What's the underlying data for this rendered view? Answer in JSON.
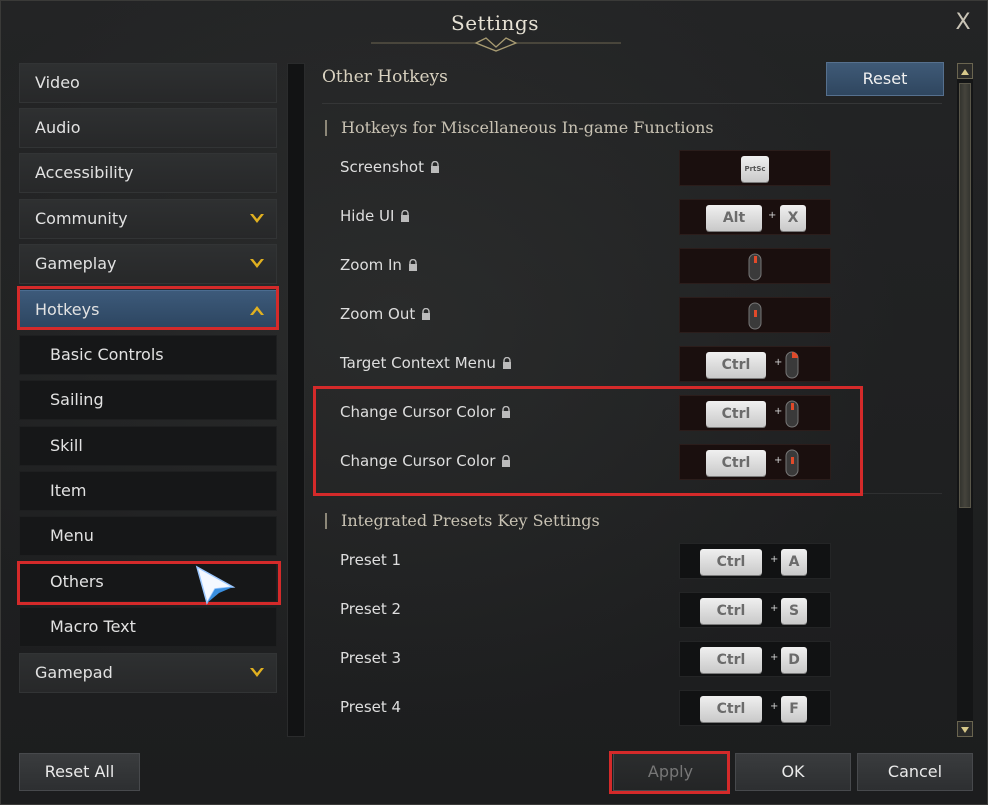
{
  "window": {
    "title": "Settings",
    "close_glyph": "X"
  },
  "sidebar": {
    "items": [
      {
        "label": "Video"
      },
      {
        "label": "Audio"
      },
      {
        "label": "Accessibility"
      },
      {
        "label": "Community",
        "expandable": true
      },
      {
        "label": "Gameplay",
        "expandable": true
      },
      {
        "label": "Hotkeys",
        "expanded": true,
        "active": true
      },
      {
        "label": "Basic Controls",
        "sub": true
      },
      {
        "label": "Sailing",
        "sub": true
      },
      {
        "label": "Skill",
        "sub": true
      },
      {
        "label": "Item",
        "sub": true
      },
      {
        "label": "Menu",
        "sub": true
      },
      {
        "label": "Others",
        "sub": true,
        "selected": true
      },
      {
        "label": "Macro Text",
        "sub": true
      },
      {
        "label": "Gamepad",
        "expandable": true
      }
    ]
  },
  "main": {
    "title": "Other Hotkeys",
    "reset_label": "Reset",
    "sections": [
      {
        "title": "Hotkeys for Miscellaneous In-game Functions",
        "rows": [
          {
            "label": "Screenshot",
            "locked": true,
            "keys": [
              "PrtSc"
            ]
          },
          {
            "label": "Hide UI",
            "locked": true,
            "keys": [
              "Alt",
              "X"
            ]
          },
          {
            "label": "Zoom In",
            "locked": true,
            "keys": [
              "mouse-wheel-up"
            ]
          },
          {
            "label": "Zoom Out",
            "locked": true,
            "keys": [
              "mouse-wheel-down"
            ]
          },
          {
            "label": "Target Context Menu",
            "locked": true,
            "keys": [
              "Ctrl",
              "mouse-right"
            ]
          },
          {
            "label": "Change Cursor Color",
            "locked": true,
            "keys": [
              "Ctrl",
              "mouse-wheel-up"
            ]
          },
          {
            "label": "Change Cursor Color",
            "locked": true,
            "keys": [
              "Ctrl",
              "mouse-wheel-down"
            ]
          }
        ]
      },
      {
        "title": "Integrated Presets Key Settings",
        "rows": [
          {
            "label": "Preset 1",
            "keys": [
              "Ctrl",
              "A"
            ]
          },
          {
            "label": "Preset 2",
            "keys": [
              "Ctrl",
              "S"
            ]
          },
          {
            "label": "Preset 3",
            "keys": [
              "Ctrl",
              "D"
            ]
          },
          {
            "label": "Preset 4",
            "keys": [
              "Ctrl",
              "F"
            ]
          }
        ]
      }
    ],
    "plus_glyph": "+"
  },
  "footer": {
    "reset_all_label": "Reset All",
    "apply_label": "Apply",
    "ok_label": "OK",
    "cancel_label": "Cancel"
  },
  "colors": {
    "accent_blue": "#3d5a7a",
    "highlight_red": "#d42a2a",
    "chevron_gold": "#e0b020"
  },
  "icons": [
    "close-icon",
    "chevron-down-icon",
    "chevron-up-icon",
    "lock-icon",
    "mouse-icon",
    "cursor-arrow-icon"
  ]
}
